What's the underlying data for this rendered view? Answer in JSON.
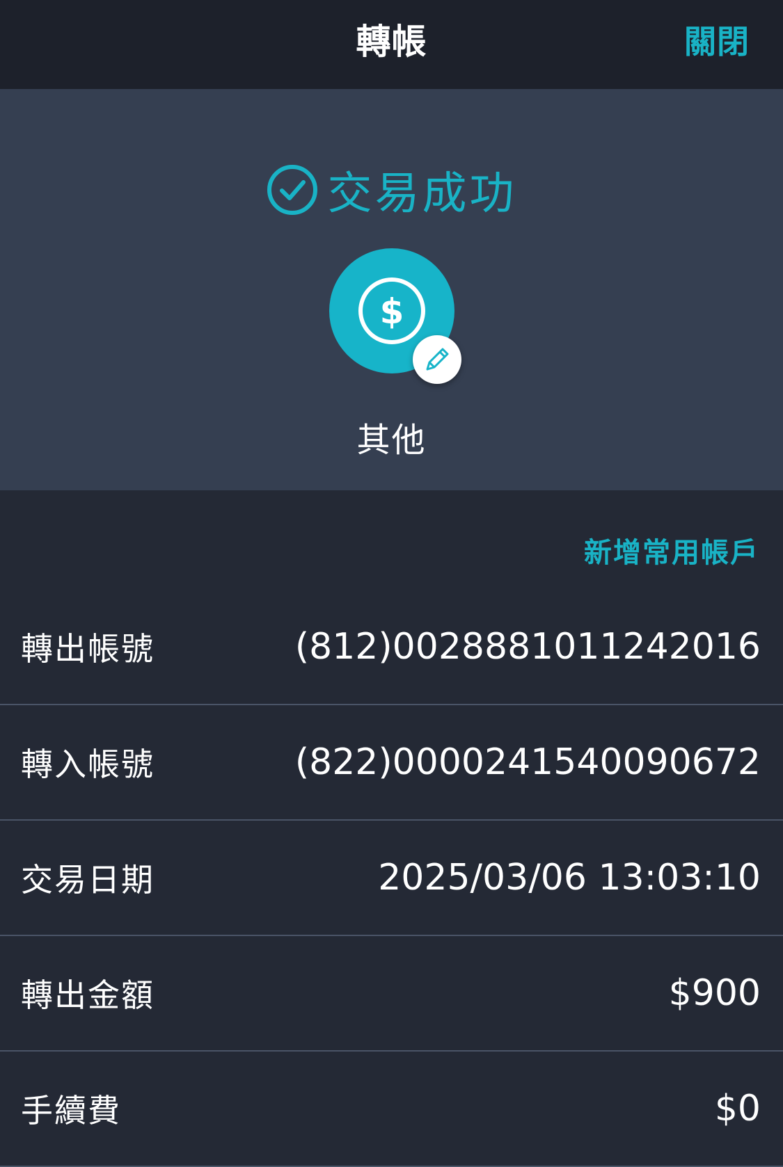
{
  "navbar": {
    "title": "轉帳",
    "close_label": "關閉"
  },
  "status": {
    "icon": "check-circle-icon",
    "text": "交易成功",
    "color": "#19b3c6"
  },
  "category": {
    "icon": "dollar-icon",
    "edit_icon": "pencil-icon",
    "label": "其他",
    "accent": "#17b4c9"
  },
  "actions": {
    "add_favorite_label": "新增常用帳戶"
  },
  "details": [
    {
      "label": "轉出帳號",
      "value": "(812)0028881011242016"
    },
    {
      "label": "轉入帳號",
      "value": "(822)0000241540090672"
    },
    {
      "label": "交易日期",
      "value": "2025/03/06 13:03:10"
    },
    {
      "label": "轉出金額",
      "value": "$900"
    },
    {
      "label": "手續費",
      "value": "$0"
    }
  ]
}
